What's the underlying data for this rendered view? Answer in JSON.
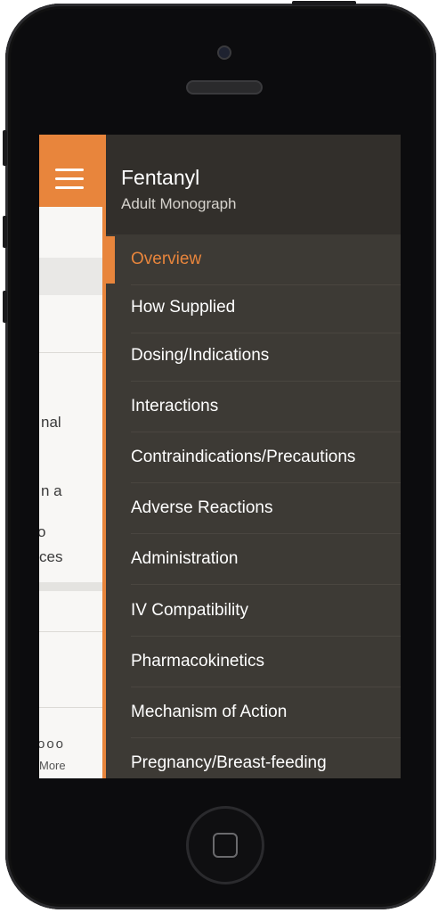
{
  "background_app": {
    "text_fragments": [
      "nal",
      "n a",
      "o",
      "ces"
    ],
    "dots": "ooo",
    "more_label": "More"
  },
  "drawer": {
    "title": "Fentanyl",
    "subtitle": "Adult Monograph",
    "items": [
      {
        "label": "Overview",
        "active": true
      },
      {
        "label": "How Supplied",
        "active": false
      },
      {
        "label": "Dosing/Indications",
        "active": false
      },
      {
        "label": "Interactions",
        "active": false
      },
      {
        "label": "Contraindications/Precautions",
        "active": false
      },
      {
        "label": "Adverse Reactions",
        "active": false
      },
      {
        "label": "Administration",
        "active": false
      },
      {
        "label": "IV Compatibility",
        "active": false
      },
      {
        "label": "Pharmacokinetics",
        "active": false
      },
      {
        "label": "Mechanism of Action",
        "active": false
      },
      {
        "label": "Pregnancy/Breast-feeding",
        "active": false
      }
    ]
  },
  "icons": {
    "menu": "hamburger-menu-icon",
    "home": "home-button-icon"
  },
  "colors": {
    "accent": "#e8853c",
    "drawer_bg": "#3d3a35",
    "drawer_header_bg": "#322f2b",
    "text": "#ffffff"
  }
}
